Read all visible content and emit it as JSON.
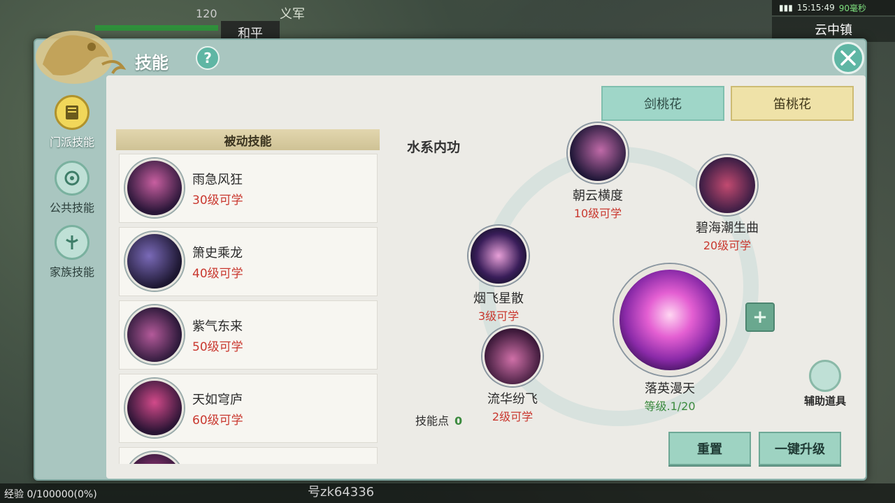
{
  "hud": {
    "top_name": "义军",
    "peace_mode": "和平",
    "level_partial": "120",
    "status_time": "15:15:49",
    "status_ping": "90毫秒",
    "town": "云中镇",
    "exp": "经验 0/100000(0%)",
    "player_id": "号zk64336"
  },
  "panel": {
    "title": "技能",
    "help": "?"
  },
  "side_tabs": [
    {
      "label": "门派技能",
      "active": true
    },
    {
      "label": "公共技能",
      "active": false
    },
    {
      "label": "家族技能",
      "active": false
    }
  ],
  "passive": {
    "header": "被动技能",
    "skills": [
      {
        "name": "雨急风狂",
        "level": "30级可学"
      },
      {
        "name": "箫史乘龙",
        "level": "40级可学"
      },
      {
        "name": "紫气东来",
        "level": "50级可学"
      },
      {
        "name": "天如穹庐",
        "level": "60级可学"
      }
    ]
  },
  "school_tabs": [
    "剑桃花",
    "笛桃花"
  ],
  "section_title": "水系内功",
  "skill_tree": {
    "nodes": [
      {
        "name": "朝云横度",
        "level": "10级可学"
      },
      {
        "name": "碧海潮生曲",
        "level": "20级可学"
      },
      {
        "name": "烟飞星散",
        "level": "3级可学"
      },
      {
        "name": "流华纷飞",
        "level": "2级可学"
      },
      {
        "name": "落英漫天",
        "level": "等级.1/20"
      }
    ],
    "plus": "+"
  },
  "skill_points": {
    "label": "技能点",
    "value": "0"
  },
  "aux_item": "辅助道具",
  "buttons": {
    "reset": "重置",
    "upgrade_all": "一键升级"
  },
  "colors": {
    "panel": "#a9c6c0",
    "content": "#ecebe6",
    "level_red": "#c9382f",
    "level_green": "#3b8a3e"
  }
}
